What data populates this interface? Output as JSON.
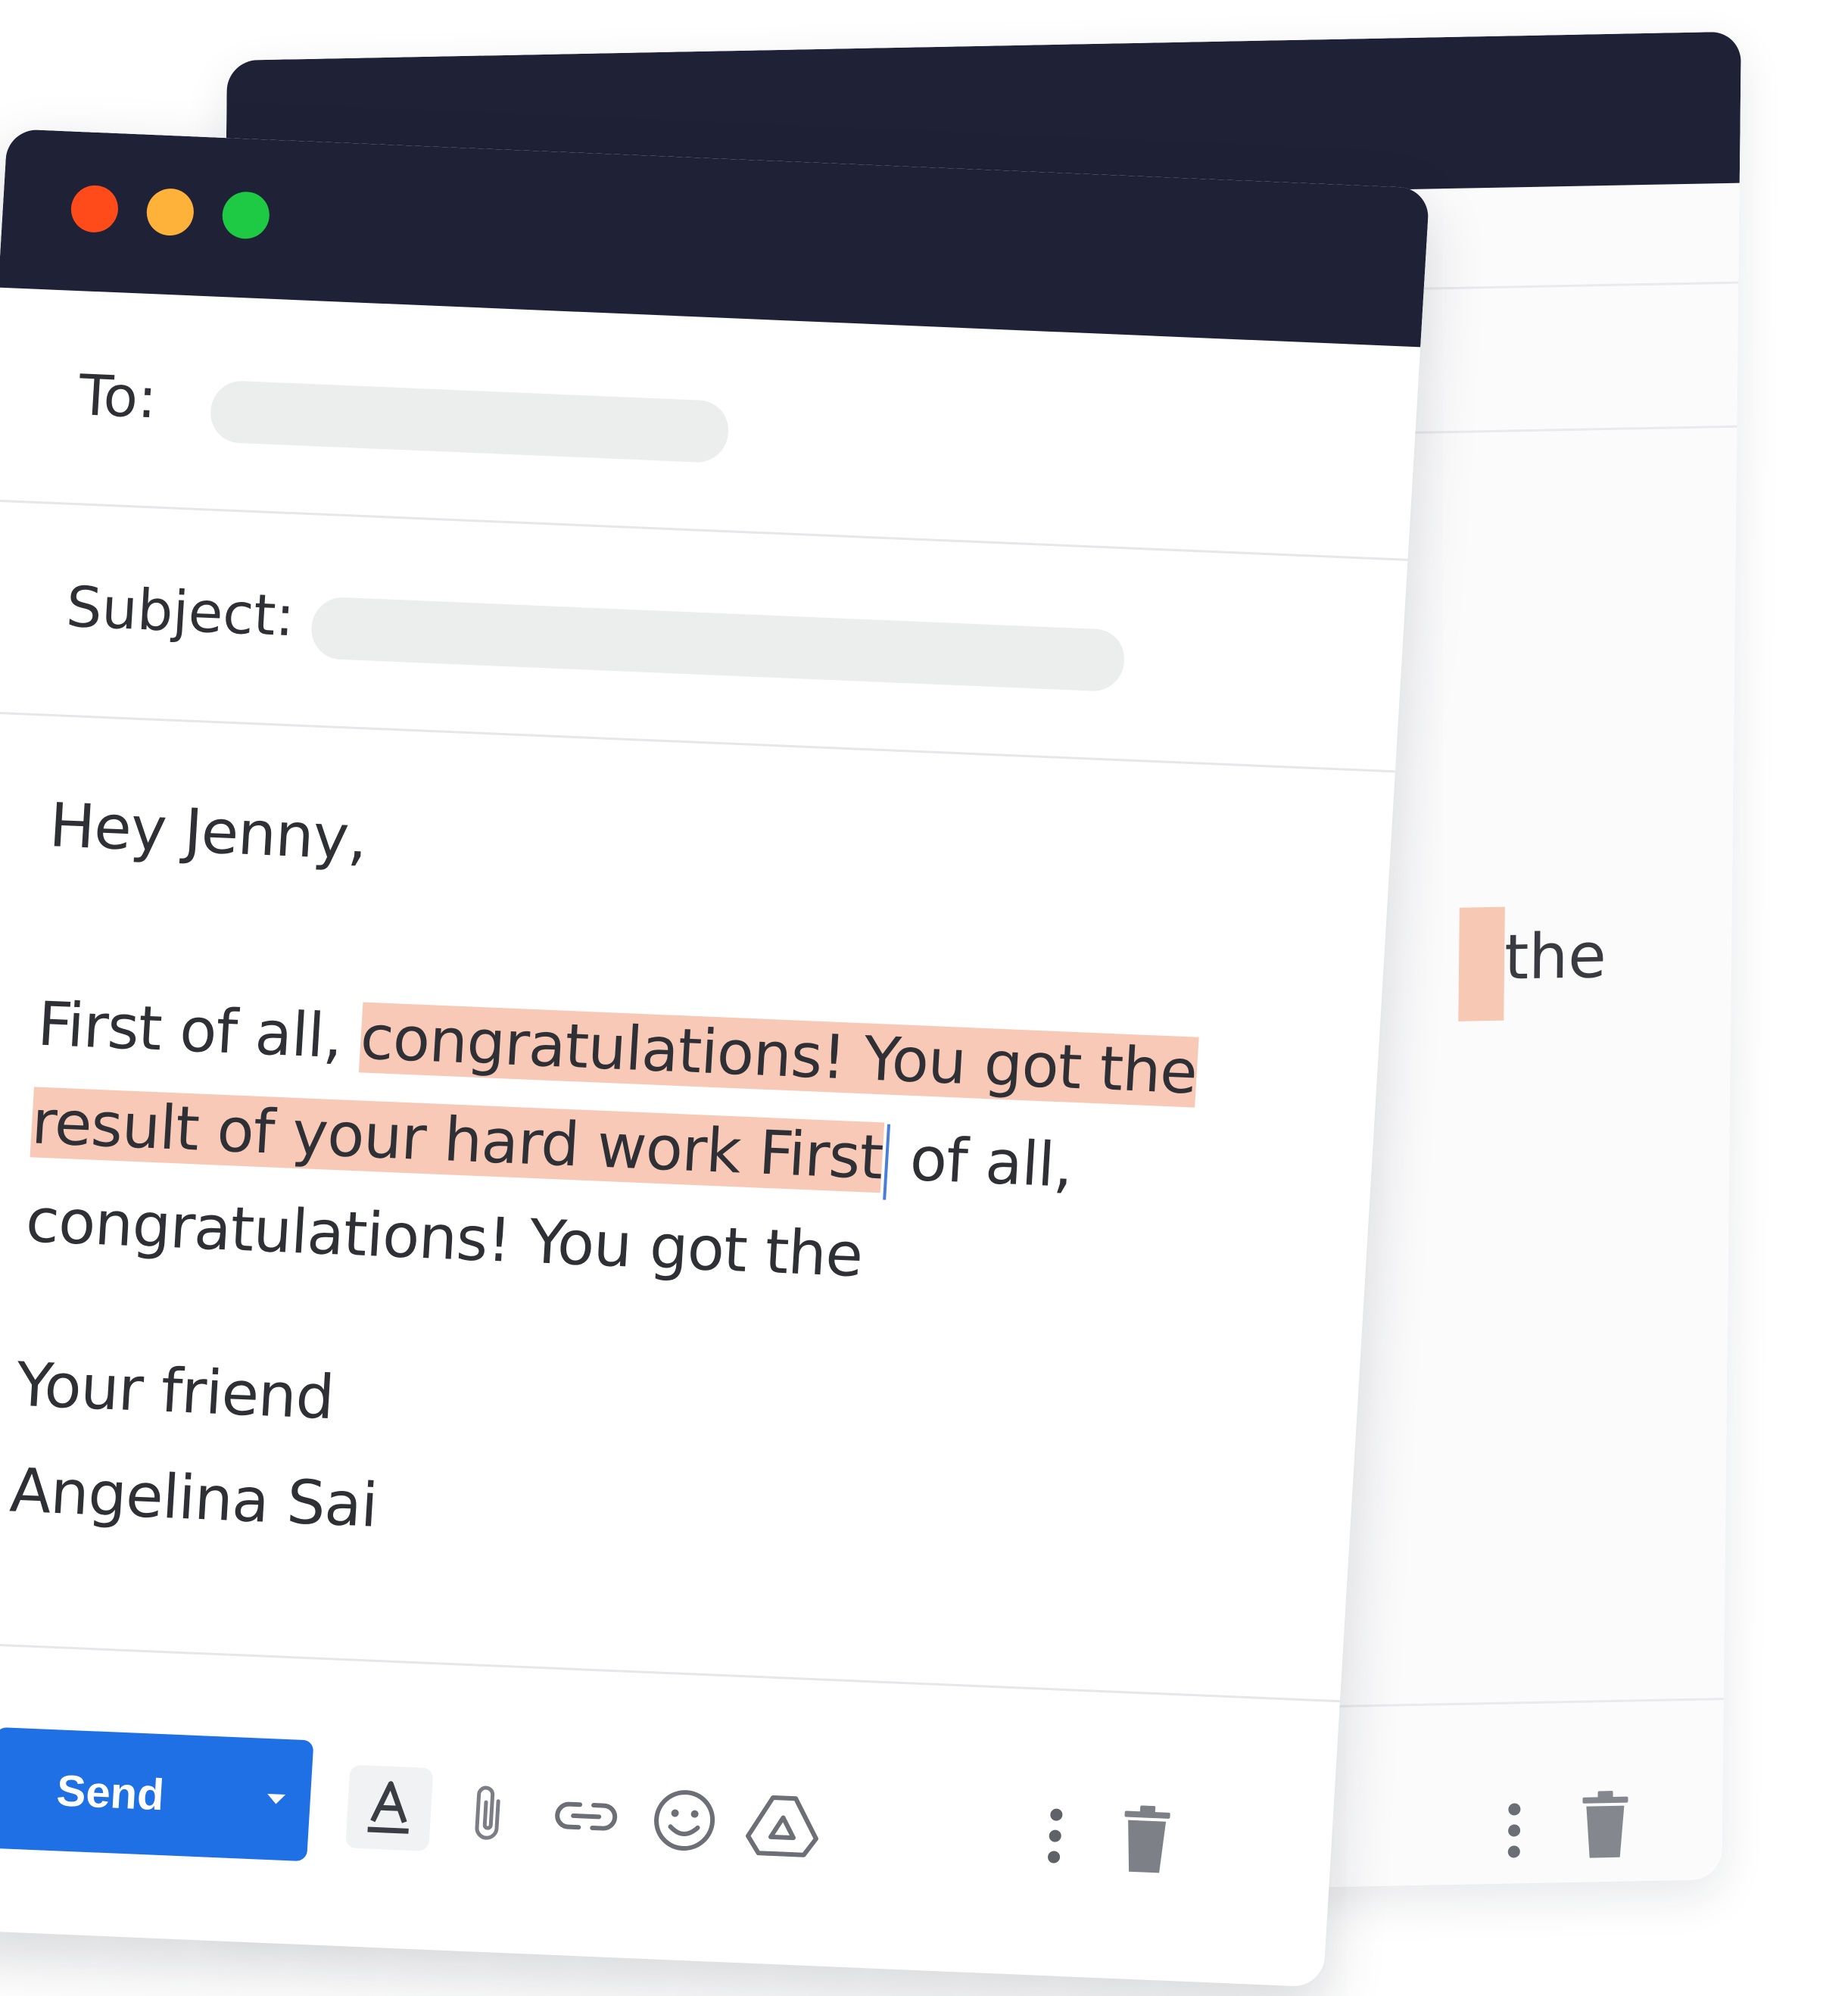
{
  "compose": {
    "to_label": "To:",
    "to_value": "",
    "subject_label": "Subject:",
    "subject_value": "",
    "greeting": "Hey Jenny,",
    "body_lines": [
      {
        "before": "First of all, ",
        "highlight": "congratulations! You got the",
        "after": ""
      },
      {
        "before": "",
        "highlight": "result of your hard work First",
        "after": " of all,"
      },
      {
        "before": "",
        "highlight": "",
        "after": "congratulations! You got the"
      }
    ],
    "signoff": "Your friend",
    "signature": "Angelina Sai"
  },
  "toolbar": {
    "send_label": "Send",
    "send_dropdown_icon": "caret-down-icon",
    "icons": [
      "text-format-icon",
      "attach-icon",
      "link-icon",
      "emoji-icon",
      "drive-icon",
      "more-vert-icon",
      "trash-icon"
    ]
  },
  "back_window": {
    "visible_text": "the"
  },
  "colors": {
    "titlebar": "#1f2137",
    "send_button": "#1f70e4",
    "highlight": "#f8c9b6",
    "traffic_red": "#ff4b1a",
    "traffic_yellow": "#ffb23a",
    "traffic_green": "#1ec944"
  }
}
